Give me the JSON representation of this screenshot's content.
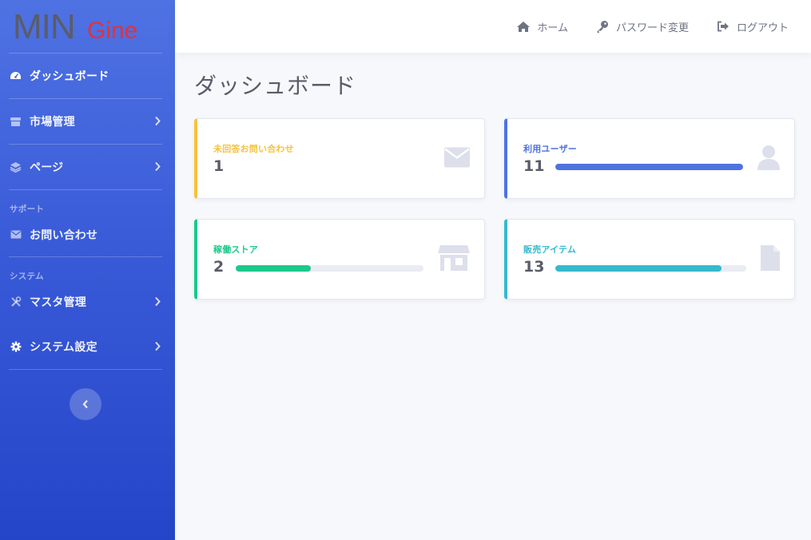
{
  "logo": {
    "part1": "MIN",
    "part2": "Gine"
  },
  "sidebar": {
    "items": [
      {
        "label": "ダッシュボード",
        "icon": "dashboard-icon"
      },
      {
        "label": "市場管理",
        "icon": "market-icon"
      },
      {
        "label": "ページ",
        "icon": "layers-icon"
      }
    ],
    "support": {
      "header": "サポート",
      "items": [
        {
          "label": "お問い合わせ",
          "icon": "envelope-icon"
        }
      ]
    },
    "system": {
      "header": "システム",
      "items": [
        {
          "label": "マスタ管理",
          "icon": "tools-icon"
        },
        {
          "label": "システム設定",
          "icon": "gear-icon"
        }
      ]
    }
  },
  "topbar": {
    "home": "ホーム",
    "password": "パスワード変更",
    "logout": "ログアウト"
  },
  "page": {
    "title": "ダッシュボード"
  },
  "cards": [
    {
      "title": "未回答お問い合わせ",
      "value": "1",
      "color": "#f6c23e",
      "icon": "envelope-icon"
    },
    {
      "title": "利用ユーザー",
      "value": "11",
      "color": "#4e73df",
      "progress": 1.0,
      "icon": "user-icon"
    },
    {
      "title": "稼働ストア",
      "value": "2",
      "color": "#1cc88a",
      "progress": 0.4,
      "icon": "store-icon"
    },
    {
      "title": "販売アイテム",
      "value": "13",
      "color": "#36b9cc",
      "progress": 0.87,
      "icon": "file-icon"
    }
  ],
  "colors": {
    "sidebar_top": "#4f72e3",
    "sidebar_bottom": "#2445c8",
    "logo_gray": "#5a5c69",
    "logo_red": "#e0333a"
  }
}
